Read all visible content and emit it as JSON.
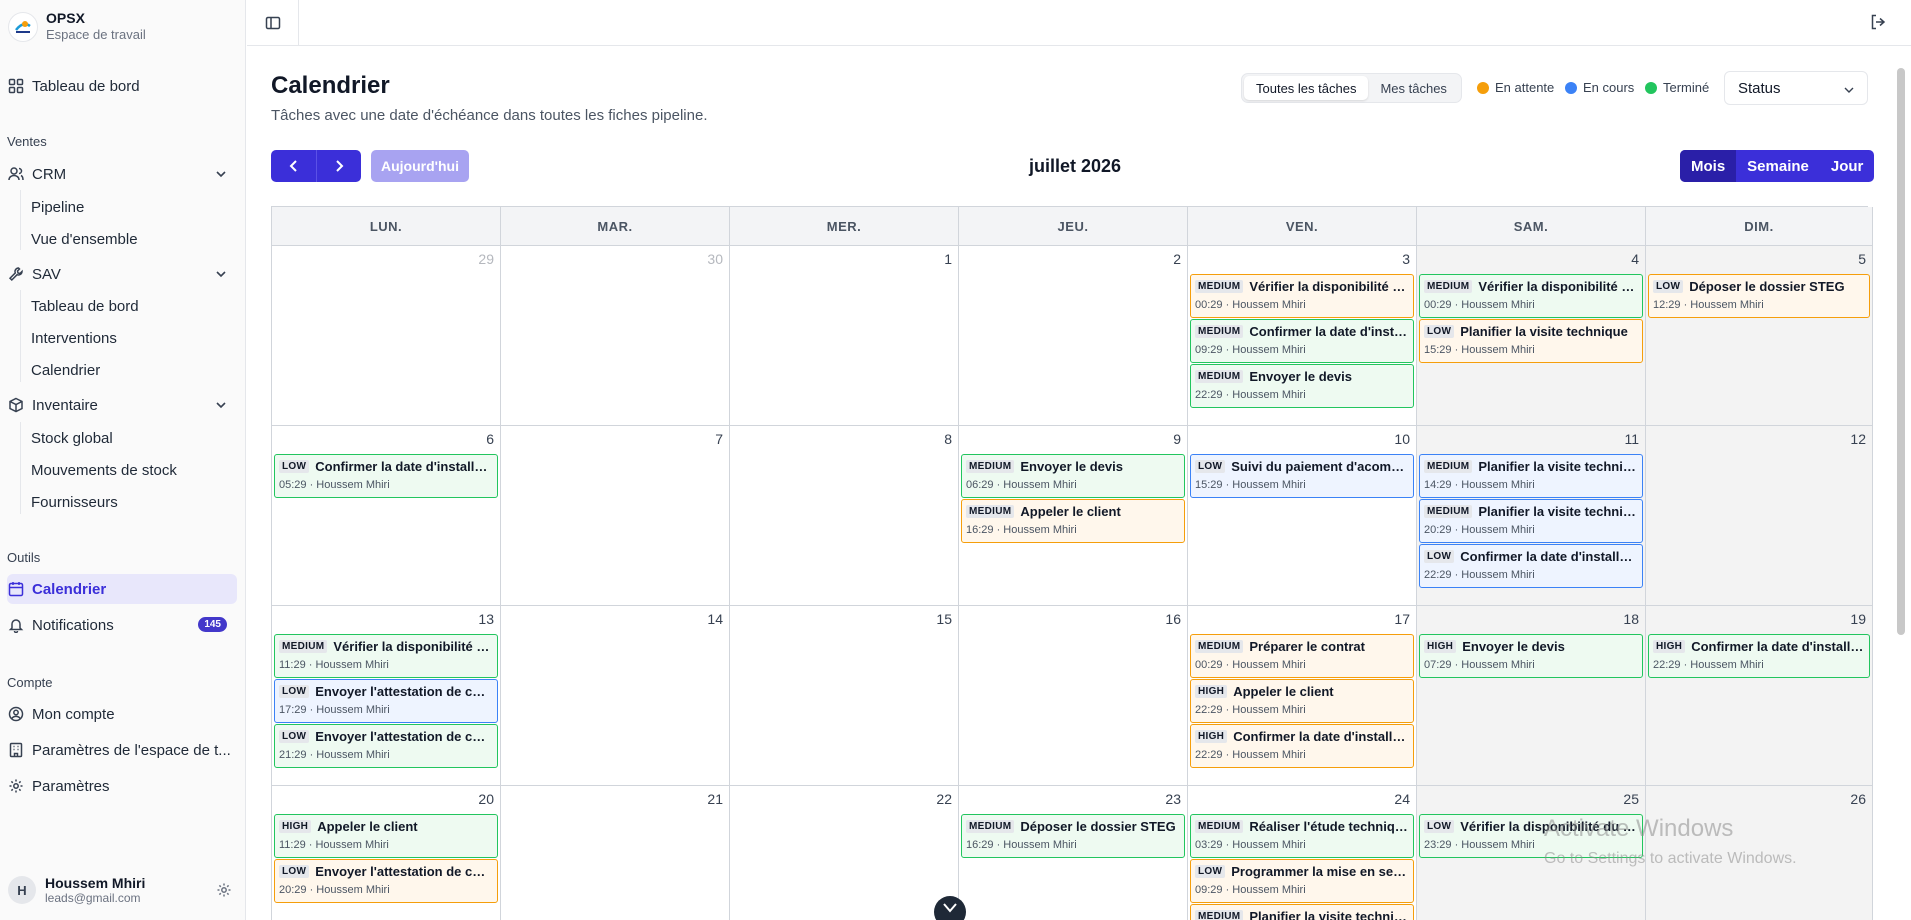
{
  "app": {
    "name": "OPSX",
    "workspace": "Espace de travail"
  },
  "sidebar": {
    "dashboard": "Tableau de bord",
    "sections": {
      "ventes": "Ventes",
      "outils": "Outils",
      "compte": "Compte"
    },
    "crm": {
      "label": "CRM",
      "items": [
        "Pipeline",
        "Vue d'ensemble"
      ]
    },
    "sav": {
      "label": "SAV",
      "items": [
        "Tableau de bord",
        "Interventions",
        "Calendrier"
      ]
    },
    "inventaire": {
      "label": "Inventaire",
      "items": [
        "Stock global",
        "Mouvements de stock",
        "Fournisseurs"
      ]
    },
    "calendar": "Calendrier",
    "notifications": {
      "label": "Notifications",
      "count": "145"
    },
    "account": "Mon compte",
    "workspace_settings": "Paramètres de l'espace de t...",
    "settings": "Paramètres",
    "user": {
      "initial": "H",
      "name": "Houssem Mhiri",
      "email": "leads@gmail.com"
    }
  },
  "header": {
    "title": "Calendrier",
    "subtitle": "Tâches avec une date d'échéance dans toutes les fiches pipeline.",
    "filter_all": "Toutes les tâches",
    "filter_mine": "Mes tâches",
    "legend": [
      {
        "label": "En attente",
        "color": "#f59e0b"
      },
      {
        "label": "En cours",
        "color": "#3b82f6"
      },
      {
        "label": "Terminé",
        "color": "#22c55e"
      }
    ],
    "status_select": "Status"
  },
  "nav": {
    "today": "Aujourd'hui",
    "month_title": "juillet 2026",
    "views": [
      "Mois",
      "Semaine",
      "Jour"
    ],
    "active_view": "Mois"
  },
  "calendar": {
    "weekdays": [
      "LUN.",
      "MAR.",
      "MER.",
      "JEU.",
      "VEN.",
      "SAM.",
      "DIM."
    ],
    "weeks": [
      [
        {
          "day": "29",
          "other": true,
          "events": []
        },
        {
          "day": "30",
          "other": true,
          "events": []
        },
        {
          "day": "1",
          "events": []
        },
        {
          "day": "2",
          "events": []
        },
        {
          "day": "3",
          "events": [
            {
              "priority": "MEDIUM",
              "title": "Vérifier la disponibilité du matériel",
              "meta": "00:29 · Houssem Mhiri",
              "color": "orange"
            },
            {
              "priority": "MEDIUM",
              "title": "Confirmer la date d'installation",
              "meta": "09:29 · Houssem Mhiri",
              "color": "green"
            },
            {
              "priority": "MEDIUM",
              "title": "Envoyer le devis",
              "meta": "22:29 · Houssem Mhiri",
              "color": "green"
            }
          ]
        },
        {
          "day": "4",
          "events": [
            {
              "priority": "MEDIUM",
              "title": "Vérifier la disponibilité du matériel",
              "meta": "00:29 · Houssem Mhiri",
              "color": "green"
            },
            {
              "priority": "LOW",
              "title": "Planifier la visite technique",
              "meta": "15:29 · Houssem Mhiri",
              "color": "orange"
            }
          ]
        },
        {
          "day": "5",
          "events": [
            {
              "priority": "LOW",
              "title": "Déposer le dossier STEG",
              "meta": "12:29 · Houssem Mhiri",
              "color": "orange"
            }
          ]
        }
      ],
      [
        {
          "day": "6",
          "events": [
            {
              "priority": "LOW",
              "title": "Confirmer la date d'installation",
              "meta": "05:29 · Houssem Mhiri",
              "color": "green"
            }
          ]
        },
        {
          "day": "7",
          "events": []
        },
        {
          "day": "8",
          "events": []
        },
        {
          "day": "9",
          "events": [
            {
              "priority": "MEDIUM",
              "title": "Envoyer le devis",
              "meta": "06:29 · Houssem Mhiri",
              "color": "green"
            },
            {
              "priority": "MEDIUM",
              "title": "Appeler le client",
              "meta": "16:29 · Houssem Mhiri",
              "color": "orange"
            }
          ]
        },
        {
          "day": "10",
          "events": [
            {
              "priority": "LOW",
              "title": "Suivi du paiement d'acompte",
              "meta": "15:29 · Houssem Mhiri",
              "color": "blue"
            }
          ]
        },
        {
          "day": "11",
          "events": [
            {
              "priority": "MEDIUM",
              "title": "Planifier la visite technique",
              "meta": "14:29 · Houssem Mhiri",
              "color": "blue"
            },
            {
              "priority": "MEDIUM",
              "title": "Planifier la visite technique",
              "meta": "20:29 · Houssem Mhiri",
              "color": "blue"
            },
            {
              "priority": "LOW",
              "title": "Confirmer la date d'installation",
              "meta": "22:29 · Houssem Mhiri",
              "color": "blue"
            }
          ]
        },
        {
          "day": "12",
          "events": []
        }
      ],
      [
        {
          "day": "13",
          "events": [
            {
              "priority": "MEDIUM",
              "title": "Vérifier la disponibilité du matériel",
              "meta": "11:29 · Houssem Mhiri",
              "color": "green"
            },
            {
              "priority": "LOW",
              "title": "Envoyer l'attestation de conformité",
              "meta": "17:29 · Houssem Mhiri",
              "color": "blue"
            },
            {
              "priority": "LOW",
              "title": "Envoyer l'attestation de conformité",
              "meta": "21:29 · Houssem Mhiri",
              "color": "green"
            }
          ]
        },
        {
          "day": "14",
          "events": []
        },
        {
          "day": "15",
          "events": []
        },
        {
          "day": "16",
          "events": []
        },
        {
          "day": "17",
          "events": [
            {
              "priority": "MEDIUM",
              "title": "Préparer le contrat",
              "meta": "00:29 · Houssem Mhiri",
              "color": "orange"
            },
            {
              "priority": "HIGH",
              "title": "Appeler le client",
              "meta": "22:29 · Houssem Mhiri",
              "color": "orange"
            },
            {
              "priority": "HIGH",
              "title": "Confirmer la date d'installation",
              "meta": "22:29 · Houssem Mhiri",
              "color": "orange"
            }
          ]
        },
        {
          "day": "18",
          "events": [
            {
              "priority": "HIGH",
              "title": "Envoyer le devis",
              "meta": "07:29 · Houssem Mhiri",
              "color": "green"
            }
          ]
        },
        {
          "day": "19",
          "events": [
            {
              "priority": "HIGH",
              "title": "Confirmer la date d'installation",
              "meta": "22:29 · Houssem Mhiri",
              "color": "green"
            }
          ]
        }
      ],
      [
        {
          "day": "20",
          "events": [
            {
              "priority": "HIGH",
              "title": "Appeler le client",
              "meta": "11:29 · Houssem Mhiri",
              "color": "green"
            },
            {
              "priority": "LOW",
              "title": "Envoyer l'attestation de conformité",
              "meta": "20:29 · Houssem Mhiri",
              "color": "orange"
            }
          ]
        },
        {
          "day": "21",
          "events": []
        },
        {
          "day": "22",
          "events": []
        },
        {
          "day": "23",
          "events": [
            {
              "priority": "MEDIUM",
              "title": "Déposer le dossier STEG",
              "meta": "16:29 · Houssem Mhiri",
              "color": "green"
            }
          ]
        },
        {
          "day": "24",
          "events": [
            {
              "priority": "MEDIUM",
              "title": "Réaliser l'étude technique",
              "meta": "03:29 · Houssem Mhiri",
              "color": "green"
            },
            {
              "priority": "LOW",
              "title": "Programmer la mise en service",
              "meta": "09:29 · Houssem Mhiri",
              "color": "orange"
            },
            {
              "priority": "MEDIUM",
              "title": "Planifier la visite technique",
              "meta": "",
              "color": "orange"
            }
          ]
        },
        {
          "day": "25",
          "events": [
            {
              "priority": "LOW",
              "title": "Vérifier la disponibilité du matériel",
              "meta": "23:29 · Houssem Mhiri",
              "color": "green"
            }
          ]
        },
        {
          "day": "26",
          "events": []
        }
      ]
    ]
  },
  "watermark": {
    "line1": "Activate Windows",
    "line2": "Go to Settings to activate Windows."
  }
}
